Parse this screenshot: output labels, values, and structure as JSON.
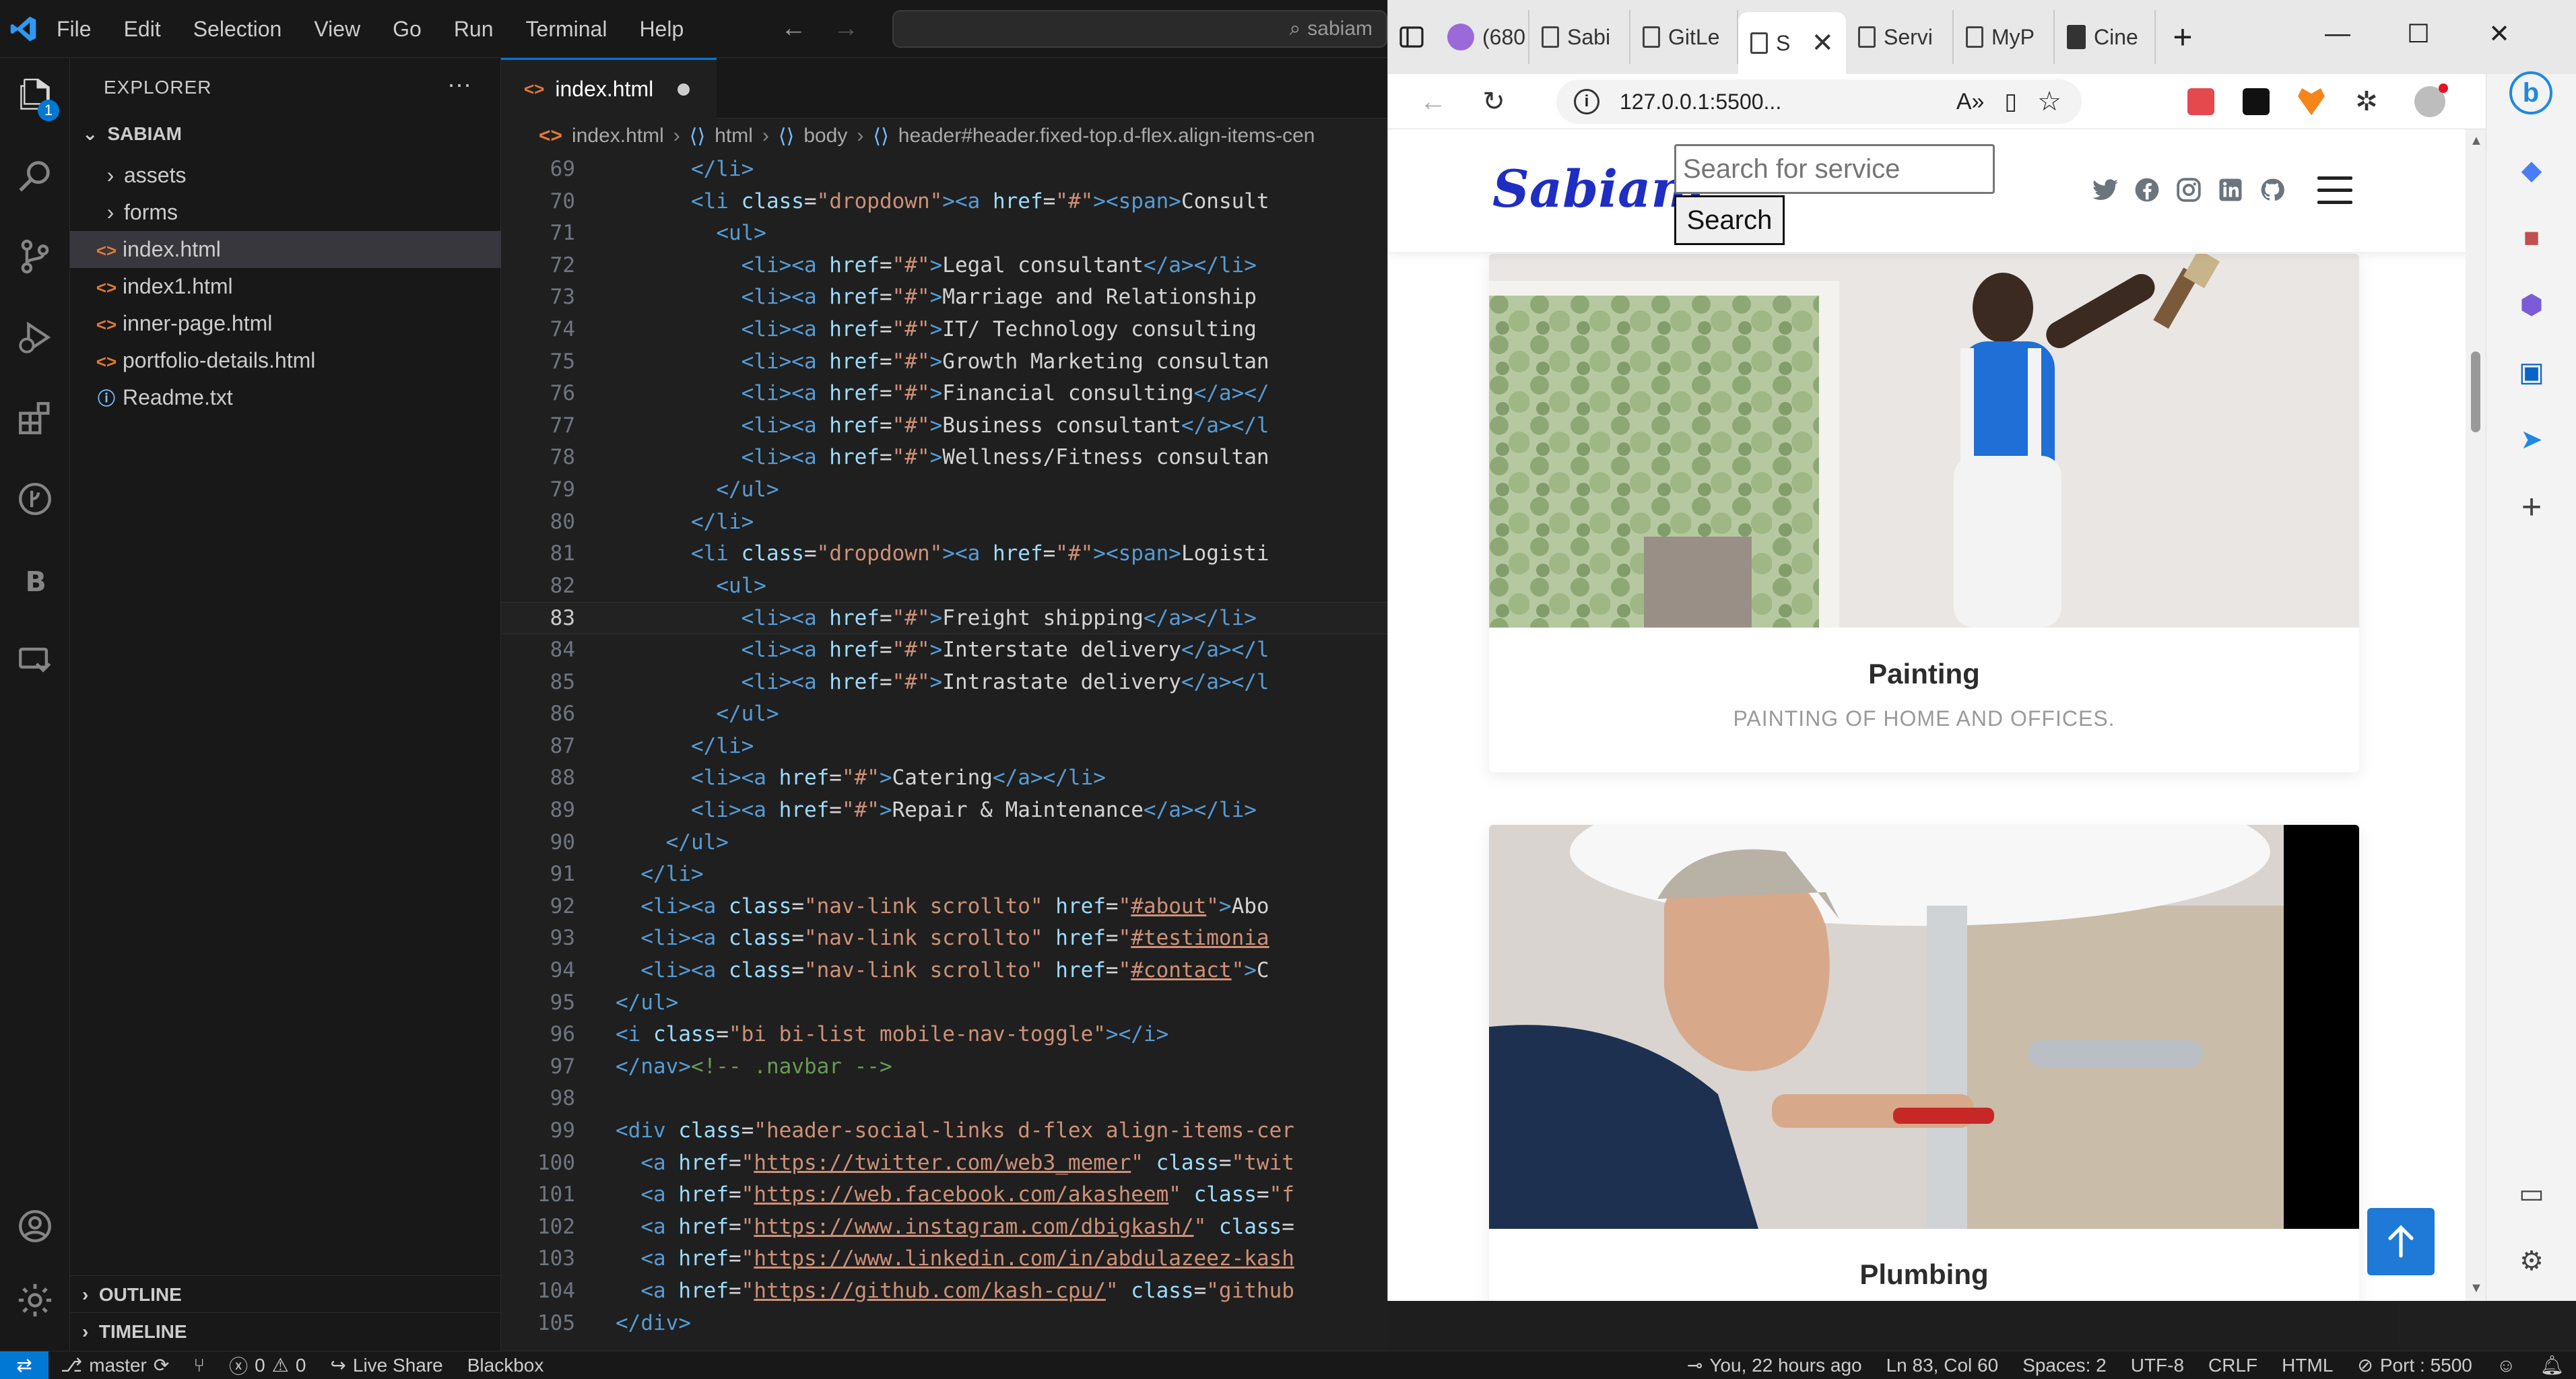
{
  "vscode": {
    "menu": [
      "File",
      "Edit",
      "Selection",
      "View",
      "Go",
      "Run",
      "Terminal",
      "Help"
    ],
    "command_center": "sabiam",
    "explorer_title": "EXPLORER",
    "explorer_more": "···",
    "root_folder": "SABIAM",
    "badge_count": "1",
    "tree": [
      {
        "label": "assets",
        "type": "folder"
      },
      {
        "label": "forms",
        "type": "folder"
      },
      {
        "label": "index.html",
        "type": "html",
        "selected": true
      },
      {
        "label": "index1.html",
        "type": "html"
      },
      {
        "label": "inner-page.html",
        "type": "html"
      },
      {
        "label": "portfolio-details.html",
        "type": "html"
      },
      {
        "label": "Readme.txt",
        "type": "info"
      }
    ],
    "outline_label": "OUTLINE",
    "timeline_label": "TIMELINE",
    "active_tab": "index.html",
    "breadcrumb": [
      "index.html",
      "html",
      "body",
      "header#header.fixed-top.d-flex.align-items-cen"
    ],
    "current_line": 83,
    "code_lines": [
      {
        "n": "69",
        "html": "      <span class='tg'>&lt;/li&gt;</span>"
      },
      {
        "n": "70",
        "html": "      <span class='tg'>&lt;li</span> <span class='an'>class</span><span class='tx'>=</span><span class='av'>\"dropdown\"</span><span class='tg'>&gt;&lt;a</span> <span class='an'>href</span><span class='tx'>=</span><span class='av'>\"#\"</span><span class='tg'>&gt;&lt;span&gt;</span><span class='tx'>Consult</span>"
      },
      {
        "n": "71",
        "html": "        <span class='tg'>&lt;ul&gt;</span>"
      },
      {
        "n": "72",
        "html": "          <span class='tg'>&lt;li&gt;&lt;a</span> <span class='an'>href</span><span class='tx'>=</span><span class='av'>\"#\"</span><span class='tg'>&gt;</span><span class='tx'>Legal consultant</span><span class='tg'>&lt;/a&gt;&lt;/li&gt;</span>"
      },
      {
        "n": "73",
        "html": "          <span class='tg'>&lt;li&gt;&lt;a</span> <span class='an'>href</span><span class='tx'>=</span><span class='av'>\"#\"</span><span class='tg'>&gt;</span><span class='tx'>Marriage and Relationship</span>"
      },
      {
        "n": "74",
        "html": "          <span class='tg'>&lt;li&gt;&lt;a</span> <span class='an'>href</span><span class='tx'>=</span><span class='av'>\"#\"</span><span class='tg'>&gt;</span><span class='tx'>IT/ Technology consulting</span>"
      },
      {
        "n": "75",
        "html": "          <span class='tg'>&lt;li&gt;&lt;a</span> <span class='an'>href</span><span class='tx'>=</span><span class='av'>\"#\"</span><span class='tg'>&gt;</span><span class='tx'>Growth Marketing consultan</span>"
      },
      {
        "n": "76",
        "html": "          <span class='tg'>&lt;li&gt;&lt;a</span> <span class='an'>href</span><span class='tx'>=</span><span class='av'>\"#\"</span><span class='tg'>&gt;</span><span class='tx'>Financial consulting</span><span class='tg'>&lt;/a&gt;&lt;/</span>"
      },
      {
        "n": "77",
        "html": "          <span class='tg'>&lt;li&gt;&lt;a</span> <span class='an'>href</span><span class='tx'>=</span><span class='av'>\"#\"</span><span class='tg'>&gt;</span><span class='tx'>Business consultant</span><span class='tg'>&lt;/a&gt;&lt;/l</span>"
      },
      {
        "n": "78",
        "html": "          <span class='tg'>&lt;li&gt;&lt;a</span> <span class='an'>href</span><span class='tx'>=</span><span class='av'>\"#\"</span><span class='tg'>&gt;</span><span class='tx'>Wellness/Fitness consultan</span>"
      },
      {
        "n": "79",
        "html": "        <span class='tg'>&lt;/ul&gt;</span>"
      },
      {
        "n": "80",
        "html": "      <span class='tg'>&lt;/li&gt;</span>"
      },
      {
        "n": "81",
        "html": "      <span class='tg'>&lt;li</span> <span class='an'>class</span><span class='tx'>=</span><span class='av'>\"dropdown\"</span><span class='tg'>&gt;&lt;a</span> <span class='an'>href</span><span class='tx'>=</span><span class='av'>\"#\"</span><span class='tg'>&gt;&lt;span&gt;</span><span class='tx'>Logisti</span>"
      },
      {
        "n": "82",
        "html": "        <span class='tg'>&lt;ul&gt;</span>"
      },
      {
        "n": "83",
        "html": "          <span class='tg'>&lt;li&gt;&lt;a</span> <span class='an'>href</span><span class='tx'>=</span><span class='av'>\"#\"</span><span class='tg'>&gt;</span><span class='tx'>Freight shipping</span><span class='tg'>&lt;/a&gt;&lt;/li&gt;</span>"
      },
      {
        "n": "84",
        "html": "          <span class='tg'>&lt;li&gt;&lt;a</span> <span class='an'>href</span><span class='tx'>=</span><span class='av'>\"#\"</span><span class='tg'>&gt;</span><span class='tx'>Interstate delivery</span><span class='tg'>&lt;/a&gt;&lt;/l</span>"
      },
      {
        "n": "85",
        "html": "          <span class='tg'>&lt;li&gt;&lt;a</span> <span class='an'>href</span><span class='tx'>=</span><span class='av'>\"#\"</span><span class='tg'>&gt;</span><span class='tx'>Intrastate delivery</span><span class='tg'>&lt;/a&gt;&lt;/l</span>"
      },
      {
        "n": "86",
        "html": "        <span class='tg'>&lt;/ul&gt;</span>"
      },
      {
        "n": "87",
        "html": "      <span class='tg'>&lt;/li&gt;</span>"
      },
      {
        "n": "88",
        "html": "      <span class='tg'>&lt;li&gt;&lt;a</span> <span class='an'>href</span><span class='tx'>=</span><span class='av'>\"#\"</span><span class='tg'>&gt;</span><span class='tx'>Catering</span><span class='tg'>&lt;/a&gt;&lt;/li&gt;</span>"
      },
      {
        "n": "89",
        "html": "      <span class='tg'>&lt;li&gt;&lt;a</span> <span class='an'>href</span><span class='tx'>=</span><span class='av'>\"#\"</span><span class='tg'>&gt;</span><span class='tx'>Repair &amp; Maintenance</span><span class='tg'>&lt;/a&gt;&lt;/li&gt;</span>"
      },
      {
        "n": "90",
        "html": "    <span class='tg'>&lt;/ul&gt;</span>"
      },
      {
        "n": "91",
        "html": "  <span class='tg'>&lt;/li&gt;</span>"
      },
      {
        "n": "92",
        "html": "  <span class='tg'>&lt;li&gt;&lt;a</span> <span class='an'>class</span><span class='tx'>=</span><span class='av'>\"nav-link scrollto\"</span> <span class='an'>href</span><span class='tx'>=</span><span class='av'>\"<span class='ul'>#about</span>\"</span><span class='tg'>&gt;</span><span class='tx'>Abo</span>"
      },
      {
        "n": "93",
        "html": "  <span class='tg'>&lt;li&gt;&lt;a</span> <span class='an'>class</span><span class='tx'>=</span><span class='av'>\"nav-link scrollto\"</span> <span class='an'>href</span><span class='tx'>=</span><span class='av'>\"<span class='ul'>#testimonia</span></span>"
      },
      {
        "n": "94",
        "html": "  <span class='tg'>&lt;li&gt;&lt;a</span> <span class='an'>class</span><span class='tx'>=</span><span class='av'>\"nav-link scrollto\"</span> <span class='an'>href</span><span class='tx'>=</span><span class='av'>\"<span class='ul'>#contact</span>\"</span><span class='tg'>&gt;</span><span class='tx'>C</span>"
      },
      {
        "n": "95",
        "html": "<span class='tg'>&lt;/ul&gt;</span>"
      },
      {
        "n": "96",
        "html": "<span class='tg'>&lt;i</span> <span class='an'>class</span><span class='tx'>=</span><span class='av'>\"bi bi-list mobile-nav-toggle\"</span><span class='tg'>&gt;&lt;/i&gt;</span>"
      },
      {
        "n": "97",
        "html": "<span class='tg'>&lt;/nav&gt;</span><span class='cm'>&lt;!-- .navbar --&gt;</span>"
      },
      {
        "n": "98",
        "html": ""
      },
      {
        "n": "99",
        "html": "<span class='tg'>&lt;div</span> <span class='an'>class</span><span class='tx'>=</span><span class='av'>\"header-social-links d-flex align-items-cer</span>"
      },
      {
        "n": "100",
        "html": "  <span class='tg'>&lt;a</span> <span class='an'>href</span><span class='tx'>=</span><span class='av'>\"<span class='ul'>https://twitter.com/web3_memer</span>\"</span> <span class='an'>class</span><span class='tx'>=</span><span class='av'>\"twit</span>"
      },
      {
        "n": "101",
        "html": "  <span class='tg'>&lt;a</span> <span class='an'>href</span><span class='tx'>=</span><span class='av'>\"<span class='ul'>https://web.facebook.com/akasheem</span>\"</span> <span class='an'>class</span><span class='tx'>=</span><span class='av'>\"f</span>"
      },
      {
        "n": "102",
        "html": "  <span class='tg'>&lt;a</span> <span class='an'>href</span><span class='tx'>=</span><span class='av'>\"<span class='ul'>https://www.instagram.com/dbigkash/</span>\"</span> <span class='an'>class</span><span class='tx'>=</span>"
      },
      {
        "n": "103",
        "html": "  <span class='tg'>&lt;a</span> <span class='an'>href</span><span class='tx'>=</span><span class='av'>\"<span class='ul'>https://www.linkedin.com/in/abdulazeez-kash</span></span>"
      },
      {
        "n": "104",
        "html": "  <span class='tg'>&lt;a</span> <span class='an'>href</span><span class='tx'>=</span><span class='av'>\"<span class='ul'>https://github.com/kash-cpu/</span>\"</span> <span class='an'>class</span><span class='tx'>=</span><span class='av'>\"github</span>"
      },
      {
        "n": "105",
        "html": "<span class='tg'>&lt;/div&gt;</span>"
      }
    ]
  },
  "statusbar": {
    "branch": "master",
    "problems_errors": "0",
    "problems_warnings": "0",
    "live_share": "Live Share",
    "blackbox": "Blackbox",
    "git_blame": "You, 22 hours ago",
    "cursor": "Ln 83, Col 60",
    "spaces": "Spaces: 2",
    "encoding": "UTF-8",
    "eol": "CRLF",
    "language": "HTML",
    "port": "Port : 5500"
  },
  "browser": {
    "tabs": [
      {
        "label": "(680",
        "icon": "mail"
      },
      {
        "label": "Sabi",
        "icon": "page"
      },
      {
        "label": "GitLe",
        "icon": "page"
      },
      {
        "label": "S",
        "icon": "page",
        "active": true
      },
      {
        "label": "Servi",
        "icon": "page"
      },
      {
        "label": "MyP",
        "icon": "page"
      },
      {
        "label": "Cine",
        "icon": "film"
      }
    ],
    "url": "127.0.0.1:5500...",
    "site": {
      "logo": "Sabiam.",
      "search_placeholder": "Search for service",
      "search_button": "Search",
      "cards": [
        {
          "title": "Painting",
          "subtitle": "PAINTING OF HOME AND OFFICES."
        },
        {
          "title": "Plumbing",
          "subtitle": ""
        }
      ]
    }
  },
  "colors": {
    "vscode_accent": "#0078d4",
    "site_logo": "#1f2ec2",
    "back_to_top": "#1e7ad6"
  }
}
